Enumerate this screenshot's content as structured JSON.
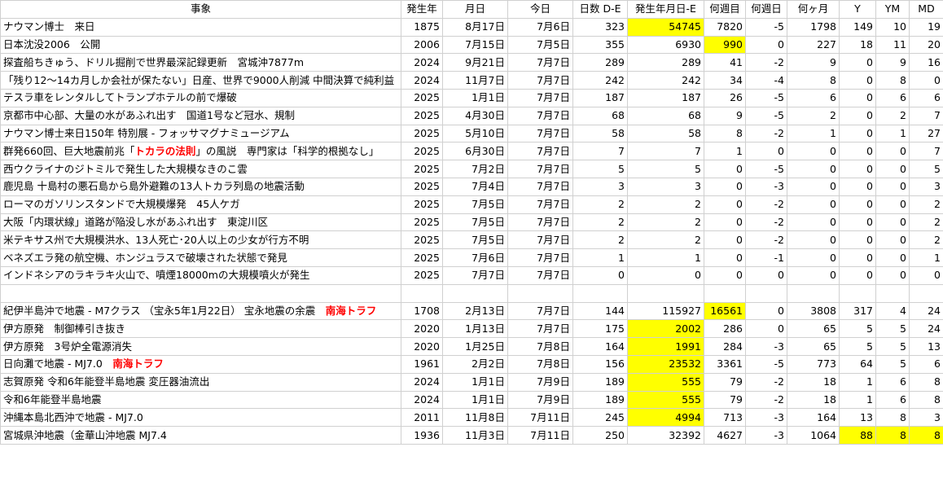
{
  "headers": [
    "事象",
    "発生年",
    "月日",
    "今日",
    "日数 D-E",
    "発生年月日-E",
    "何週目",
    "何週日",
    "何ヶ月",
    "Y",
    "YM",
    "MD"
  ],
  "rows_top": [
    {
      "event": "ナウマン博士　来日",
      "red": "",
      "after": "",
      "year": "1875",
      "md": "8月17日",
      "today": "7月6日",
      "days": "323",
      "total": "54745",
      "weeks": "7820",
      "wd": "-5",
      "months": "1798",
      "y": "149",
      "ym": "10",
      "mdd": "19",
      "hl": [
        "total"
      ]
    },
    {
      "event": "日本沈没2006　公開",
      "red": "",
      "after": "",
      "year": "2006",
      "md": "7月15日",
      "today": "7月5日",
      "days": "355",
      "total": "6930",
      "weeks": "990",
      "wd": "0",
      "months": "227",
      "y": "18",
      "ym": "11",
      "mdd": "20",
      "hl": [
        "weeks"
      ]
    },
    {
      "event": "探査船ちきゅう、ドリル掘削で世界最深記録更新　宮城沖7877m",
      "red": "",
      "after": "",
      "year": "2024",
      "md": "9月21日",
      "today": "7月7日",
      "days": "289",
      "total": "289",
      "weeks": "41",
      "wd": "-2",
      "months": "9",
      "y": "0",
      "ym": "9",
      "mdd": "16",
      "hl": []
    },
    {
      "event": "「残り12～14カ月しか会社が保たない」日産、世界で9000人削減 中間決算で純利益",
      "red": "",
      "after": "",
      "year": "2024",
      "md": "11月7日",
      "today": "7月7日",
      "days": "242",
      "total": "242",
      "weeks": "34",
      "wd": "-4",
      "months": "8",
      "y": "0",
      "ym": "8",
      "mdd": "0",
      "hl": []
    },
    {
      "event": "テスラ車をレンタルしてトランプホテルの前で爆破",
      "red": "",
      "after": "",
      "year": "2025",
      "md": "1月1日",
      "today": "7月7日",
      "days": "187",
      "total": "187",
      "weeks": "26",
      "wd": "-5",
      "months": "6",
      "y": "0",
      "ym": "6",
      "mdd": "6",
      "hl": []
    },
    {
      "event": "京都市中心部、大量の水があふれ出す　国道1号など冠水、規制",
      "red": "",
      "after": "",
      "year": "2025",
      "md": "4月30日",
      "today": "7月7日",
      "days": "68",
      "total": "68",
      "weeks": "9",
      "wd": "-5",
      "months": "2",
      "y": "0",
      "ym": "2",
      "mdd": "7",
      "hl": []
    },
    {
      "event": "ナウマン博士来日150年 特別展 - フォッサマグナミュージアム",
      "red": "",
      "after": "",
      "year": "2025",
      "md": "5月10日",
      "today": "7月7日",
      "days": "58",
      "total": "58",
      "weeks": "8",
      "wd": "-2",
      "months": "1",
      "y": "0",
      "ym": "1",
      "mdd": "27",
      "hl": []
    },
    {
      "event": "群発660回、巨大地震前兆「",
      "red": "トカラの法則",
      "after": "」の風説　専門家は「科学的根拠なし」",
      "year": "2025",
      "md": "6月30日",
      "today": "7月7日",
      "days": "7",
      "total": "7",
      "weeks": "1",
      "wd": "0",
      "months": "0",
      "y": "0",
      "ym": "0",
      "mdd": "7",
      "hl": []
    },
    {
      "event": "西ウクライナのジトミルで発生した大規模なきのこ雲",
      "red": "",
      "after": "",
      "year": "2025",
      "md": "7月2日",
      "today": "7月7日",
      "days": "5",
      "total": "5",
      "weeks": "0",
      "wd": "-5",
      "months": "0",
      "y": "0",
      "ym": "0",
      "mdd": "5",
      "hl": []
    },
    {
      "event": "鹿児島 十島村の悪石島から島外避難の13人トカラ列島の地震活動",
      "red": "",
      "after": "",
      "year": "2025",
      "md": "7月4日",
      "today": "7月7日",
      "days": "3",
      "total": "3",
      "weeks": "0",
      "wd": "-3",
      "months": "0",
      "y": "0",
      "ym": "0",
      "mdd": "3",
      "hl": []
    },
    {
      "event": "ローマのガソリンスタンドで大規模爆発　45人ケガ",
      "red": "",
      "after": "",
      "year": "2025",
      "md": "7月5日",
      "today": "7月7日",
      "days": "2",
      "total": "2",
      "weeks": "0",
      "wd": "-2",
      "months": "0",
      "y": "0",
      "ym": "0",
      "mdd": "2",
      "hl": []
    },
    {
      "event": "大阪「内環状線」道路が陥没し水があふれ出す　東淀川区",
      "red": "",
      "after": "",
      "year": "2025",
      "md": "7月5日",
      "today": "7月7日",
      "days": "2",
      "total": "2",
      "weeks": "0",
      "wd": "-2",
      "months": "0",
      "y": "0",
      "ym": "0",
      "mdd": "2",
      "hl": []
    },
    {
      "event": "米テキサス州で大規模洪水、13人死亡･20人以上の少女が行方不明",
      "red": "",
      "after": "",
      "year": "2025",
      "md": "7月5日",
      "today": "7月7日",
      "days": "2",
      "total": "2",
      "weeks": "0",
      "wd": "-2",
      "months": "0",
      "y": "0",
      "ym": "0",
      "mdd": "2",
      "hl": []
    },
    {
      "event": "ベネズエラ発の航空機、ホンジュラスで破壊された状態で発見",
      "red": "",
      "after": "",
      "year": "2025",
      "md": "7月6日",
      "today": "7月7日",
      "days": "1",
      "total": "1",
      "weeks": "0",
      "wd": "-1",
      "months": "0",
      "y": "0",
      "ym": "0",
      "mdd": "1",
      "hl": []
    },
    {
      "event": "インドネシアのラキラキ火山で、噴煙18000mの大規模噴火が発生",
      "red": "",
      "after": "",
      "year": "2025",
      "md": "7月7日",
      "today": "7月7日",
      "days": "0",
      "total": "0",
      "weeks": "0",
      "wd": "0",
      "months": "0",
      "y": "0",
      "ym": "0",
      "mdd": "0",
      "hl": []
    }
  ],
  "rows_bottom": [
    {
      "event": "紀伊半島沖で地震 - M7クラス （宝永5年1月22日） 宝永地震の余震　",
      "red": "南海トラフ",
      "after": "",
      "year": "1708",
      "md": "2月13日",
      "today": "7月7日",
      "days": "144",
      "total": "115927",
      "weeks": "16561",
      "wd": "0",
      "months": "3808",
      "y": "317",
      "ym": "4",
      "mdd": "24",
      "hl": [
        "weeks"
      ]
    },
    {
      "event": "伊方原発　制御棒引き抜き",
      "red": "",
      "after": "",
      "year": "2020",
      "md": "1月13日",
      "today": "7月7日",
      "days": "175",
      "total": "2002",
      "weeks": "286",
      "wd": "0",
      "months": "65",
      "y": "5",
      "ym": "5",
      "mdd": "24",
      "hl": [
        "total"
      ]
    },
    {
      "event": "伊方原発　3号炉全電源消失",
      "red": "",
      "after": "",
      "year": "2020",
      "md": "1月25日",
      "today": "7月8日",
      "days": "164",
      "total": "1991",
      "weeks": "284",
      "wd": "-3",
      "months": "65",
      "y": "5",
      "ym": "5",
      "mdd": "13",
      "hl": [
        "total"
      ]
    },
    {
      "event": "日向灘で地震 - MJ7.0　",
      "red": "南海トラフ",
      "after": "",
      "year": "1961",
      "md": "2月2日",
      "today": "7月8日",
      "days": "156",
      "total": "23532",
      "weeks": "3361",
      "wd": "-5",
      "months": "773",
      "y": "64",
      "ym": "5",
      "mdd": "6",
      "hl": [
        "total"
      ]
    },
    {
      "event": "志賀原発 令和6年能登半島地震 変圧器油流出",
      "red": "",
      "after": "",
      "year": "2024",
      "md": "1月1日",
      "today": "7月9日",
      "days": "189",
      "total": "555",
      "weeks": "79",
      "wd": "-2",
      "months": "18",
      "y": "1",
      "ym": "6",
      "mdd": "8",
      "hl": [
        "total"
      ]
    },
    {
      "event": "令和6年能登半島地震",
      "red": "",
      "after": "",
      "year": "2024",
      "md": "1月1日",
      "today": "7月9日",
      "days": "189",
      "total": "555",
      "weeks": "79",
      "wd": "-2",
      "months": "18",
      "y": "1",
      "ym": "6",
      "mdd": "8",
      "hl": [
        "total"
      ]
    },
    {
      "event": "沖縄本島北西沖で地震 - MJ7.0",
      "red": "",
      "after": "",
      "year": "2011",
      "md": "11月8日",
      "today": "7月11日",
      "days": "245",
      "total": "4994",
      "weeks": "713",
      "wd": "-3",
      "months": "164",
      "y": "13",
      "ym": "8",
      "mdd": "3",
      "hl": [
        "total"
      ]
    },
    {
      "event": "宮城県沖地震（金華山沖地震 MJ7.4",
      "red": "",
      "after": "",
      "year": "1936",
      "md": "11月3日",
      "today": "7月11日",
      "days": "250",
      "total": "32392",
      "weeks": "4627",
      "wd": "-3",
      "months": "1064",
      "y": "88",
      "ym": "8",
      "mdd": "8",
      "hl": [
        "y",
        "ym",
        "mdd"
      ]
    }
  ]
}
